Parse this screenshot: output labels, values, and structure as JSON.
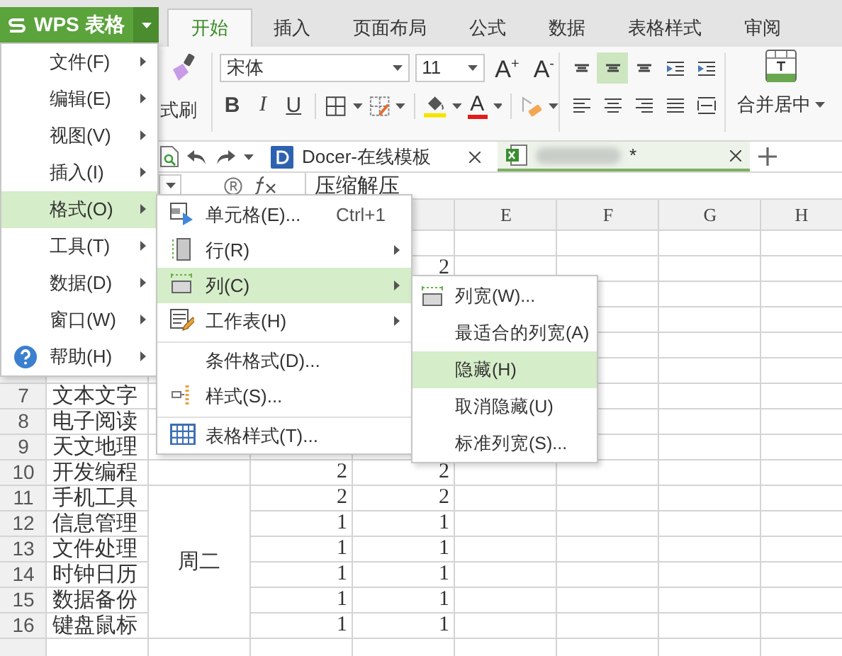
{
  "app_button": {
    "label": "WPS 表格"
  },
  "ribbon_tabs": [
    {
      "label": "开始",
      "selected": true
    },
    {
      "label": "插入",
      "selected": false
    },
    {
      "label": "页面布局",
      "selected": false
    },
    {
      "label": "公式",
      "selected": false
    },
    {
      "label": "数据",
      "selected": false
    },
    {
      "label": "表格样式",
      "selected": false
    },
    {
      "label": "审阅",
      "selected": false
    }
  ],
  "ribbon": {
    "format_painter_label": "式刷",
    "font_name": "宋体",
    "font_size": "11",
    "grow_font": "A$^{+}$",
    "shrink_font": "A$^{-}$",
    "bold": "B",
    "italic": "I",
    "underline": "U",
    "font_color": "A",
    "merge_label": "合并居中",
    "align_buttons": [
      {
        "kind": "top",
        "selected": false
      },
      {
        "kind": "middle",
        "selected": true
      },
      {
        "kind": "bottom",
        "selected": false
      },
      {
        "kind": "outdent",
        "selected": false
      },
      {
        "kind": "indent",
        "selected": false
      },
      {
        "kind": "left",
        "selected": false
      },
      {
        "kind": "center",
        "selected": false
      },
      {
        "kind": "right",
        "selected": false
      },
      {
        "kind": "justify",
        "selected": false
      },
      {
        "kind": "distribute",
        "selected": false
      }
    ]
  },
  "document_tabs": [
    {
      "kind": "docer",
      "label": "Docer-在线模板",
      "selected": false
    },
    {
      "kind": "sheet",
      "label": "*",
      "selected": true
    }
  ],
  "formula_bar": {
    "content": "压缩解压"
  },
  "columns": [
    "E",
    "F",
    "G",
    "H"
  ],
  "merged_b_text": "周二",
  "rows": [
    {},
    {
      "d": "2"
    },
    {},
    {},
    {},
    {},
    {
      "number": "7",
      "a": "文本文字"
    },
    {
      "number": "8",
      "a": "电子阅读"
    },
    {
      "number": "9",
      "a": "天文地理"
    },
    {
      "number": "10",
      "a": "开发编程",
      "c": "2",
      "d": "2"
    },
    {
      "number": "11",
      "a": "手机工具",
      "c": "2",
      "d": "2"
    },
    {
      "number": "12",
      "a": "信息管理",
      "c": "1",
      "d": "1"
    },
    {
      "number": "13",
      "a": "文件处理",
      "c": "1",
      "d": "1"
    },
    {
      "number": "14",
      "a": "时钟日历",
      "c": "1",
      "d": "1"
    },
    {
      "number": "15",
      "a": "数据备份",
      "c": "1",
      "d": "1"
    },
    {
      "number": "16",
      "a": "键盘鼠标",
      "c": "1",
      "d": "1"
    }
  ],
  "main_menu": [
    {
      "label": "文件(F)",
      "kind": "plain",
      "selected": false
    },
    {
      "label": "编辑(E)",
      "kind": "plain",
      "selected": false
    },
    {
      "label": "视图(V)",
      "kind": "plain",
      "selected": false
    },
    {
      "label": "插入(I)",
      "kind": "plain",
      "selected": false
    },
    {
      "label": "格式(O)",
      "kind": "plain",
      "selected": true
    },
    {
      "label": "工具(T)",
      "kind": "plain",
      "selected": false
    },
    {
      "label": "数据(D)",
      "kind": "plain",
      "selected": false
    },
    {
      "label": "窗口(W)",
      "kind": "plain",
      "selected": false
    },
    {
      "label": "帮助(H)",
      "kind": "help",
      "selected": false
    }
  ],
  "format_menu": [
    {
      "label": "单元格(E)...",
      "kind": "cell",
      "shortcut": "Ctrl+1",
      "submenu": false,
      "separator_before": false,
      "selected": false
    },
    {
      "label": "行(R)",
      "kind": "row",
      "submenu": true,
      "separator_before": false,
      "selected": false
    },
    {
      "label": "列(C)",
      "kind": "column",
      "submenu": true,
      "separator_before": false,
      "selected": true
    },
    {
      "label": "工作表(H)",
      "kind": "sheet",
      "submenu": true,
      "separator_before": false,
      "selected": false
    },
    {
      "label": "条件格式(D)...",
      "kind": "plain",
      "submenu": false,
      "separator_before": true,
      "selected": false
    },
    {
      "label": "样式(S)...",
      "kind": "style",
      "submenu": false,
      "separator_before": false,
      "selected": false
    },
    {
      "label": "表格样式(T)...",
      "kind": "table",
      "submenu": false,
      "separator_before": true,
      "selected": false
    }
  ],
  "column_menu": [
    {
      "label": "列宽(W)...",
      "kind": "width",
      "selected": false
    },
    {
      "label": "最适合的列宽(A)",
      "kind": "plain",
      "selected": false
    },
    {
      "label": "隐藏(H)",
      "kind": "plain",
      "selected": true
    },
    {
      "label": "取消隐藏(U)",
      "kind": "plain",
      "selected": false
    },
    {
      "label": "标准列宽(S)...",
      "kind": "plain",
      "selected": false
    }
  ]
}
